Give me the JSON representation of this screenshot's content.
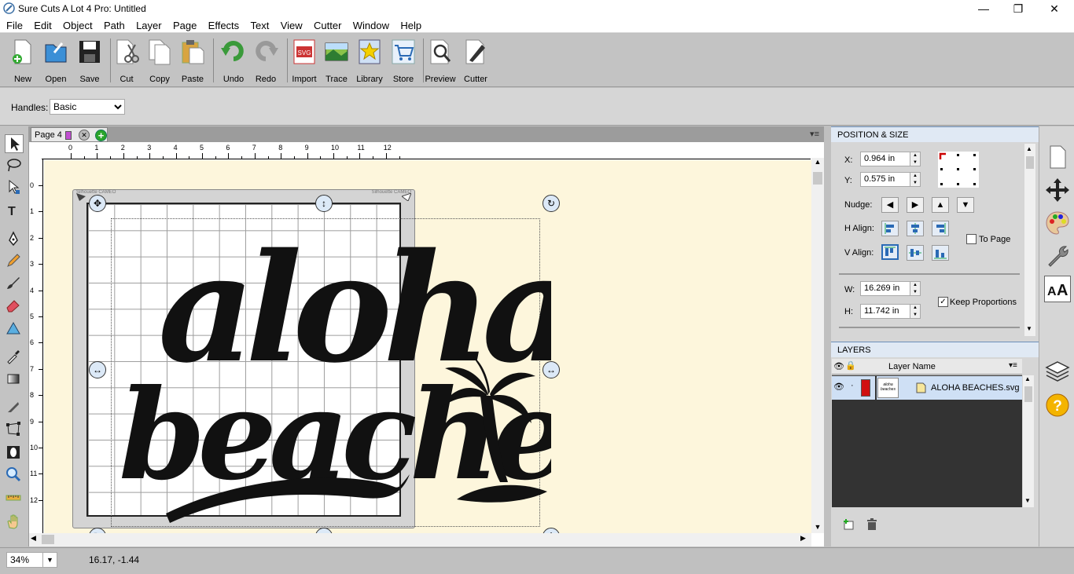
{
  "window": {
    "title": "Sure Cuts A Lot 4 Pro: Untitled",
    "minimize": "—",
    "maximize": "❐",
    "close": "✕"
  },
  "menu": [
    "File",
    "Edit",
    "Object",
    "Path",
    "Layer",
    "Page",
    "Effects",
    "Text",
    "View",
    "Cutter",
    "Window",
    "Help"
  ],
  "toolbar": [
    {
      "label": "New",
      "icon": "new-icon"
    },
    {
      "label": "Open",
      "icon": "open-icon"
    },
    {
      "label": "Save",
      "icon": "save-icon"
    },
    {
      "label": "Cut",
      "icon": "cut-icon"
    },
    {
      "label": "Copy",
      "icon": "copy-icon"
    },
    {
      "label": "Paste",
      "icon": "paste-icon"
    },
    {
      "label": "Undo",
      "icon": "undo-icon"
    },
    {
      "label": "Redo",
      "icon": "redo-icon"
    },
    {
      "label": "Import",
      "icon": "import-icon"
    },
    {
      "label": "Trace",
      "icon": "trace-icon"
    },
    {
      "label": "Library",
      "icon": "library-icon"
    },
    {
      "label": "Store",
      "icon": "store-icon"
    },
    {
      "label": "Preview",
      "icon": "preview-icon"
    },
    {
      "label": "Cutter",
      "icon": "cutter-icon"
    }
  ],
  "handles": {
    "label": "Handles:",
    "value": "Basic"
  },
  "page_tab": {
    "label": "Page 4",
    "color": "#c04ed0"
  },
  "ruler": {
    "h_ticks": [
      "0",
      "1",
      "2",
      "3",
      "4",
      "5",
      "6",
      "7",
      "8",
      "9",
      "10",
      "11",
      "12"
    ],
    "v_ticks": [
      "0",
      "1",
      "2",
      "3",
      "4",
      "5",
      "6",
      "7",
      "8",
      "9",
      "10",
      "11",
      "12"
    ]
  },
  "mat": {
    "brand_left": "Silhouette CAMEO",
    "brand_right": "Silhouette CAMEO"
  },
  "artwork": {
    "line1": "aloha",
    "line2": "beaches"
  },
  "position_size": {
    "title": "POSITION & SIZE",
    "x_label": "X:",
    "x": "0.964 in",
    "y_label": "Y:",
    "y": "0.575 in",
    "nudge_label": "Nudge:",
    "halign_label": "H Align:",
    "valign_label": "V Align:",
    "to_page": "To Page",
    "to_page_checked": false,
    "w_label": "W:",
    "w": "16.269 in",
    "h_label": "H:",
    "h": "11.742 in",
    "keep_proportions": "Keep Proportions",
    "keep_checked": true
  },
  "layers": {
    "title": "LAYERS",
    "column": "Layer Name",
    "items": [
      {
        "name": "ALOHA BEACHES.svg",
        "color": "#d01010"
      }
    ]
  },
  "status": {
    "zoom": "34%",
    "coords": "16.17, -1.44"
  }
}
